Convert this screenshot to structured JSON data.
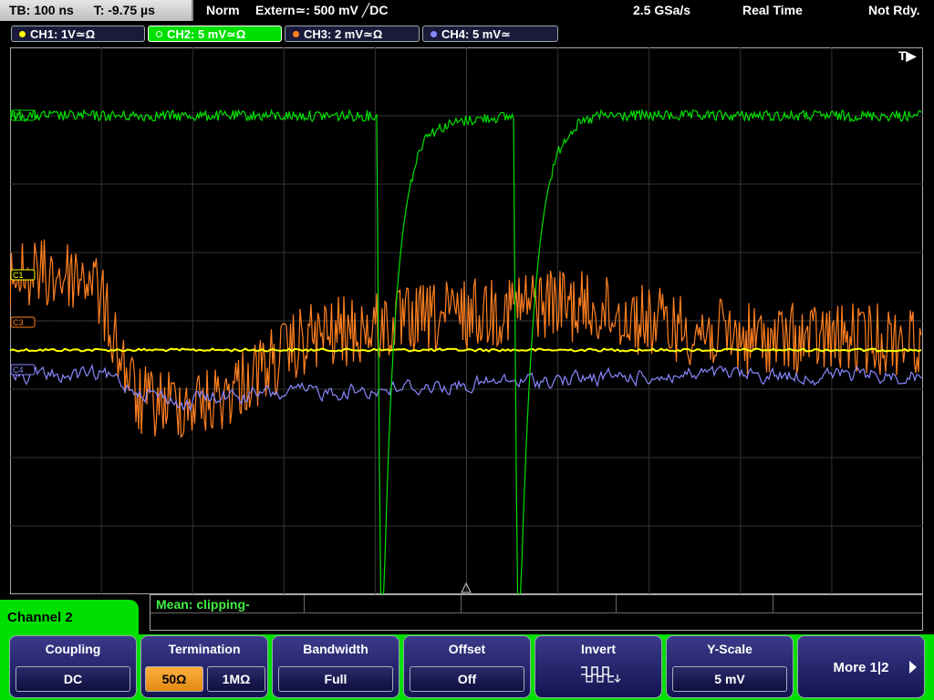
{
  "status_bar": {
    "timebase": "TB: 100 ns",
    "trigger_time": "T: -9.75 µs",
    "trigger_mode": "Norm",
    "trigger_source": "Extern≃: 500 mV ╱DC",
    "sample_rate": "2.5 GSa/s",
    "acq_mode": "Real Time",
    "run_state": "Not Rdy."
  },
  "channels": [
    {
      "label": "CH1: 1V≃Ω",
      "color": "#ffff00",
      "marker": "C1"
    },
    {
      "label": "CH2: 5 mV≃Ω",
      "color": "#00e000",
      "marker": "C2"
    },
    {
      "label": "CH3: 2 mV≃Ω",
      "color": "#ff8020",
      "marker": "C3"
    },
    {
      "label": "CH4: 5 mV≃",
      "color": "#8888ff",
      "marker": "C4"
    }
  ],
  "trigger_marker": "T▶",
  "measurement": {
    "label": "Mean: clipping-"
  },
  "menu": {
    "title": "Channel 2",
    "softkeys": {
      "coupling": {
        "title": "Coupling",
        "value": "DC"
      },
      "termination": {
        "title": "Termination",
        "options": [
          "50Ω",
          "1MΩ"
        ],
        "selected": "50Ω"
      },
      "bandwidth": {
        "title": "Bandwidth",
        "value": "Full"
      },
      "offset": {
        "title": "Offset",
        "value": "Off"
      },
      "invert": {
        "title": "Invert",
        "icon": "inverted-waveform-icon"
      },
      "yscale": {
        "title": "Y-Scale",
        "value": "5 mV"
      },
      "more": {
        "label": "More 1|2"
      }
    }
  },
  "colors": {
    "ch1": "#ffff00",
    "ch2": "#00e000",
    "ch3": "#ff8020",
    "ch4": "#8888ff",
    "menu_accent": "#00e000",
    "termination_selected": "#f0a030"
  }
}
